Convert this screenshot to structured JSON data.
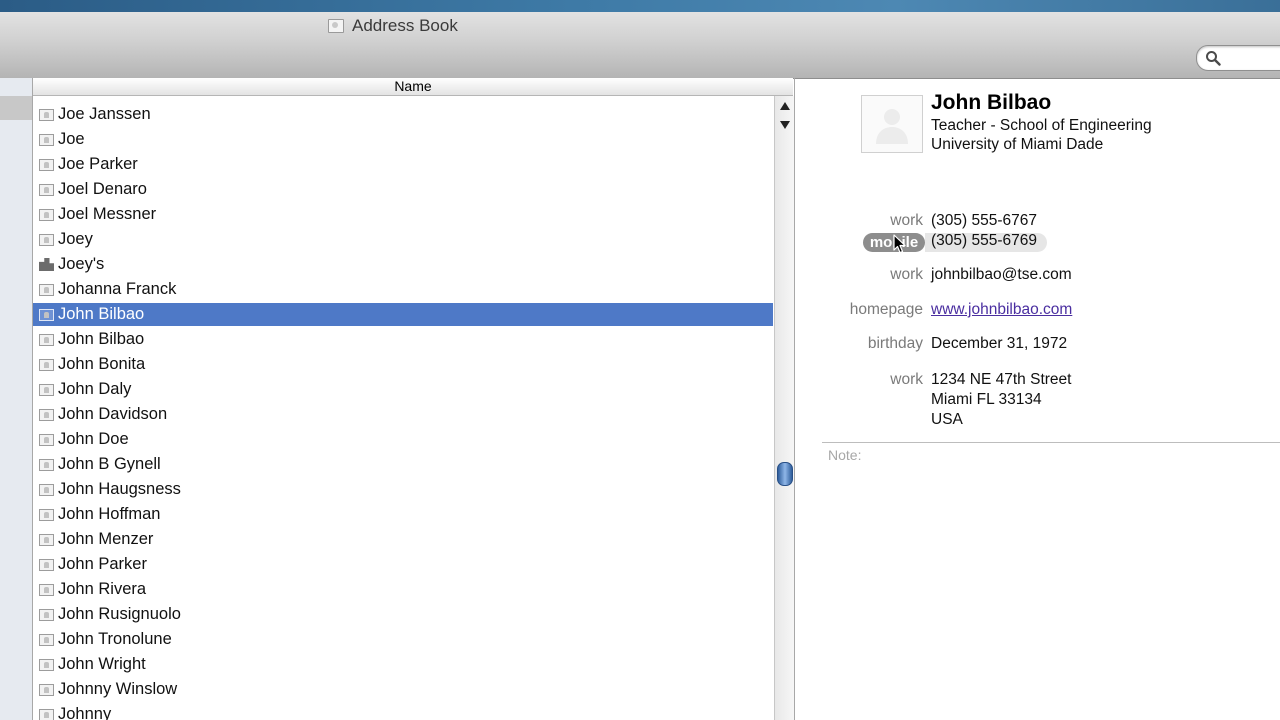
{
  "window": {
    "title": "Address Book"
  },
  "search": {
    "placeholder": ""
  },
  "list": {
    "column_header": "Name",
    "rows": [
      {
        "name": "Joe Janssen",
        "type": "person",
        "selected": false
      },
      {
        "name": "Joe",
        "type": "person",
        "selected": false
      },
      {
        "name": "Joe Parker",
        "type": "person",
        "selected": false
      },
      {
        "name": "Joel Denaro",
        "type": "person",
        "selected": false
      },
      {
        "name": "Joel Messner",
        "type": "person",
        "selected": false
      },
      {
        "name": "Joey",
        "type": "person",
        "selected": false
      },
      {
        "name": "Joey's",
        "type": "company",
        "selected": false
      },
      {
        "name": "Johanna Franck",
        "type": "person",
        "selected": false
      },
      {
        "name": "John Bilbao",
        "type": "person",
        "selected": true
      },
      {
        "name": "John Bilbao",
        "type": "person",
        "selected": false
      },
      {
        "name": "John Bonita",
        "type": "person",
        "selected": false
      },
      {
        "name": "John Daly",
        "type": "person",
        "selected": false
      },
      {
        "name": "John Davidson",
        "type": "person",
        "selected": false
      },
      {
        "name": "John Doe",
        "type": "person",
        "selected": false
      },
      {
        "name": "John B Gynell",
        "type": "person",
        "selected": false
      },
      {
        "name": "John Haugsness",
        "type": "person",
        "selected": false
      },
      {
        "name": "John Hoffman",
        "type": "person",
        "selected": false
      },
      {
        "name": "John Menzer",
        "type": "person",
        "selected": false
      },
      {
        "name": "John Parker",
        "type": "person",
        "selected": false
      },
      {
        "name": "John Rivera",
        "type": "person",
        "selected": false
      },
      {
        "name": "John Rusignuolo",
        "type": "person",
        "selected": false
      },
      {
        "name": "John Tronolune",
        "type": "person",
        "selected": false
      },
      {
        "name": "John Wright",
        "type": "person",
        "selected": false
      },
      {
        "name": "Johnny Winslow",
        "type": "person",
        "selected": false
      },
      {
        "name": "Johnny",
        "type": "person",
        "selected": false
      }
    ]
  },
  "card": {
    "name": "John Bilbao",
    "job_title": "Teacher - School of Engineering",
    "organization": "University of Miami Dade",
    "phones": [
      {
        "label": "work",
        "value": "(305) 555-6767"
      },
      {
        "label": "mobile",
        "value": "(305) 555-6769"
      }
    ],
    "email": {
      "label": "work",
      "value": "johnbilbao@tse.com"
    },
    "homepage": {
      "label": "homepage",
      "value": "www.johnbilbao.com"
    },
    "birthday": {
      "label": "birthday",
      "value": "December 31, 1972"
    },
    "address": {
      "label": "work",
      "street": "1234 NE 47th Street",
      "city_line": "Miami FL 33134",
      "country": "USA"
    },
    "note_label": "Note:"
  },
  "icons": {
    "search": "search-icon",
    "person": "person-card-icon",
    "company": "company-card-icon",
    "scroll_up": "scroll-up-arrow-icon",
    "scroll_down": "scroll-down-arrow-icon",
    "cursor": "mouse-pointer-icon"
  },
  "colors": {
    "selection": "#4e79c7",
    "link": "#4a2ea0",
    "label": "#7a7a7a"
  }
}
